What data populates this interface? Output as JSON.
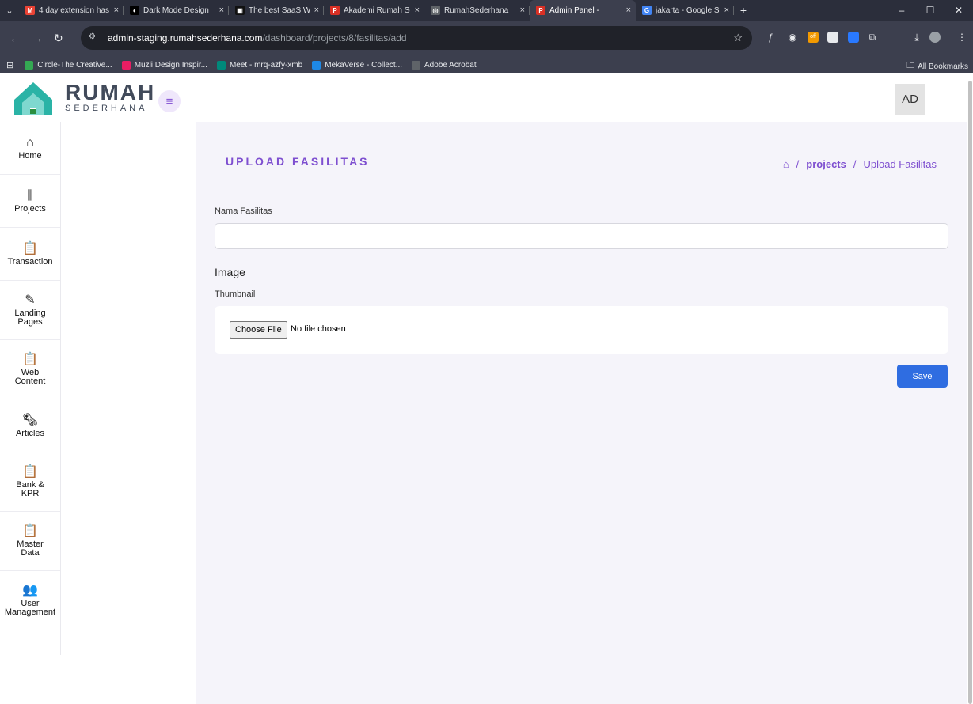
{
  "browser": {
    "tabs": [
      {
        "title": "4 day extension has",
        "icon_color": "#ea4335",
        "icon_char": "M",
        "active": false
      },
      {
        "title": "Dark Mode Design",
        "icon_color": "#000000",
        "icon_char": "◐",
        "active": false
      },
      {
        "title": "The best SaaS Web",
        "icon_color": "#111111",
        "icon_char": "▣",
        "active": false
      },
      {
        "title": "Akademi Rumah Sed",
        "icon_color": "#d93025",
        "icon_char": "P",
        "active": false
      },
      {
        "title": "RumahSederhana",
        "icon_color": "#5f6368",
        "icon_char": "◎",
        "active": false
      },
      {
        "title": "Admin Panel -",
        "icon_color": "#d93025",
        "icon_char": "P",
        "active": true
      },
      {
        "title": "jakarta - Google Sea",
        "icon_color": "#4285f4",
        "icon_char": "G",
        "active": false
      }
    ],
    "tab_close": "×",
    "new_tab": "+",
    "window_controls": {
      "minimize": "–",
      "maximize": "☐",
      "close": "✕"
    },
    "url_host": "admin-staging.rumahsederhana.com",
    "url_path": "/dashboard/projects/8/fasilitas/add",
    "bookmarks": [
      {
        "label": "Circle-The Creative...",
        "color": "#34a853"
      },
      {
        "label": "Muzli Design Inspir...",
        "color": "#e91e63"
      },
      {
        "label": "Meet - mrq-azfy-xmb",
        "color": "#00897b"
      },
      {
        "label": "MekaVerse - Collect...",
        "color": "#1e88e5"
      },
      {
        "label": "Adobe Acrobat",
        "color": "#5f6368"
      }
    ],
    "all_bookmarks": "All Bookmarks"
  },
  "header": {
    "brand_top": "RUMAH",
    "brand_bottom": "SEDERHANA",
    "avatar": "AD",
    "menu_icon": "≡"
  },
  "sidebar": {
    "items": [
      {
        "label": "Home",
        "icon": "home-icon",
        "glyph": "⌂"
      },
      {
        "label": "Projects",
        "icon": "building-icon",
        "glyph": "⫼"
      },
      {
        "label": "Transaction",
        "icon": "clipboard-icon",
        "glyph": "📋"
      },
      {
        "label": "Landing\nPages",
        "icon": "edit-icon",
        "glyph": "✎"
      },
      {
        "label": "Web\nContent",
        "icon": "clipboard-icon",
        "glyph": "📋"
      },
      {
        "label": "Articles",
        "icon": "news-icon",
        "glyph": "🗞"
      },
      {
        "label": "Bank &\nKPR",
        "icon": "clipboard-icon",
        "glyph": "📋"
      },
      {
        "label": "Master\nData",
        "icon": "clipboard-icon",
        "glyph": "📋"
      },
      {
        "label": "User\nManagement",
        "icon": "users-icon",
        "glyph": "👥"
      }
    ]
  },
  "main": {
    "title": "UPLOAD FASILITAS",
    "breadcrumb": {
      "home_icon": "⌂",
      "sep": "/",
      "projects": "projects",
      "current": "Upload Fasilitas"
    },
    "form": {
      "name_label": "Nama Fasilitas",
      "name_value": "",
      "image_heading": "Image",
      "thumbnail_label": "Thumbnail",
      "choose_file": "Choose File",
      "no_file": "No file chosen",
      "save": "Save"
    }
  }
}
